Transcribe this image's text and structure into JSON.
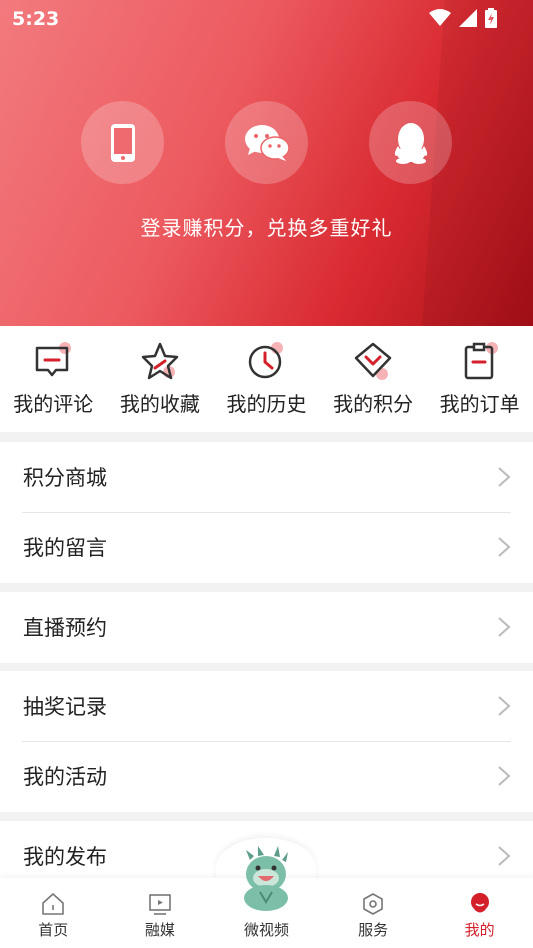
{
  "status_bar": {
    "time": "5:23"
  },
  "header": {
    "login_methods": [
      {
        "name": "phone-icon"
      },
      {
        "name": "wechat-icon"
      },
      {
        "name": "qq-icon"
      }
    ],
    "hint": "登录赚积分，兑换多重好礼"
  },
  "quick_actions": [
    {
      "label": "我的评论",
      "icon": "comment-icon"
    },
    {
      "label": "我的收藏",
      "icon": "star-icon"
    },
    {
      "label": "我的历史",
      "icon": "clock-icon"
    },
    {
      "label": "我的积分",
      "icon": "points-icon"
    },
    {
      "label": "我的订单",
      "icon": "order-icon"
    }
  ],
  "menu": {
    "group1": [
      "积分商城",
      "我的留言"
    ],
    "group2": [
      "直播预约"
    ],
    "group3": [
      "抽奖记录",
      "我的活动"
    ],
    "group4": [
      "我的发布"
    ]
  },
  "bottom_nav": [
    {
      "label": "首页",
      "icon": "home-icon"
    },
    {
      "label": "融媒",
      "icon": "media-icon"
    },
    {
      "label": "微视频",
      "icon": "mascot-icon"
    },
    {
      "label": "服务",
      "icon": "service-icon"
    },
    {
      "label": "我的",
      "icon": "profile-icon",
      "active": true
    }
  ],
  "colors": {
    "brand_red": "#d4202a",
    "accent_pink": "#f27a7e"
  }
}
